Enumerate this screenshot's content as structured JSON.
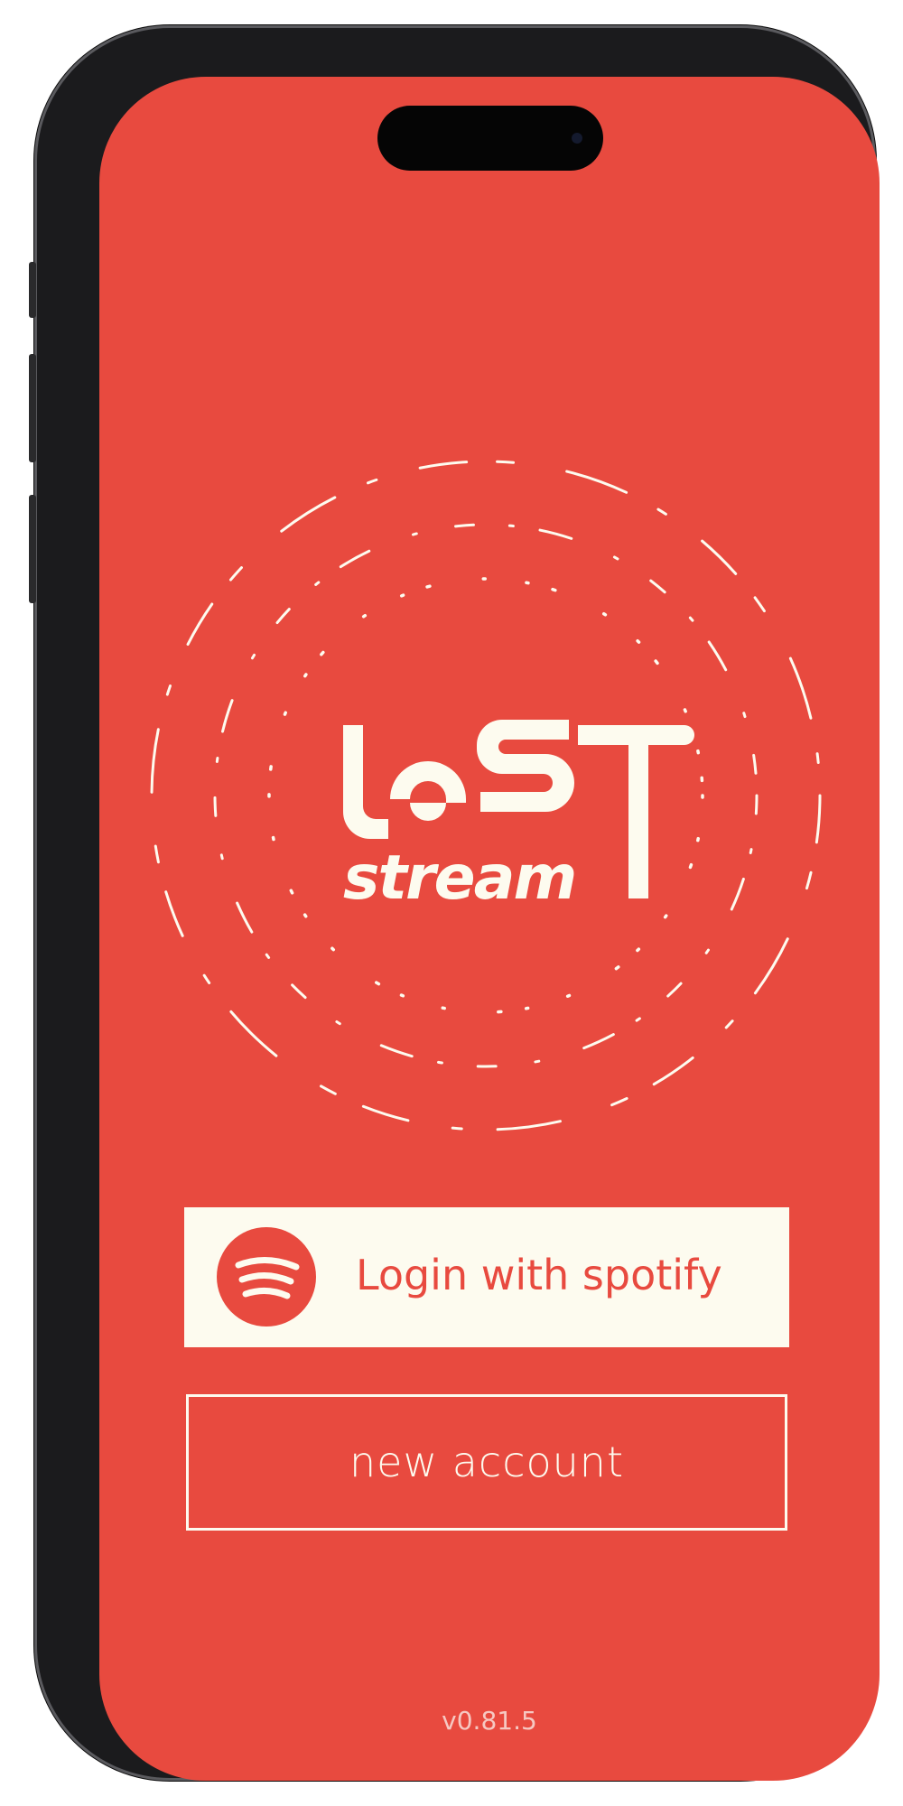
{
  "app": {
    "name": "Lost Stream",
    "logo_line1": "LOST",
    "logo_line2": "stream"
  },
  "colors": {
    "accent": "#e84a3f",
    "cream": "#fdfbef",
    "device": "#1b1b1d"
  },
  "buttons": {
    "spotify_label": "Login with spotify",
    "spotify_icon": "spotify-icon",
    "new_account_label": "new account"
  },
  "footer": {
    "version": "v0.81.5"
  }
}
